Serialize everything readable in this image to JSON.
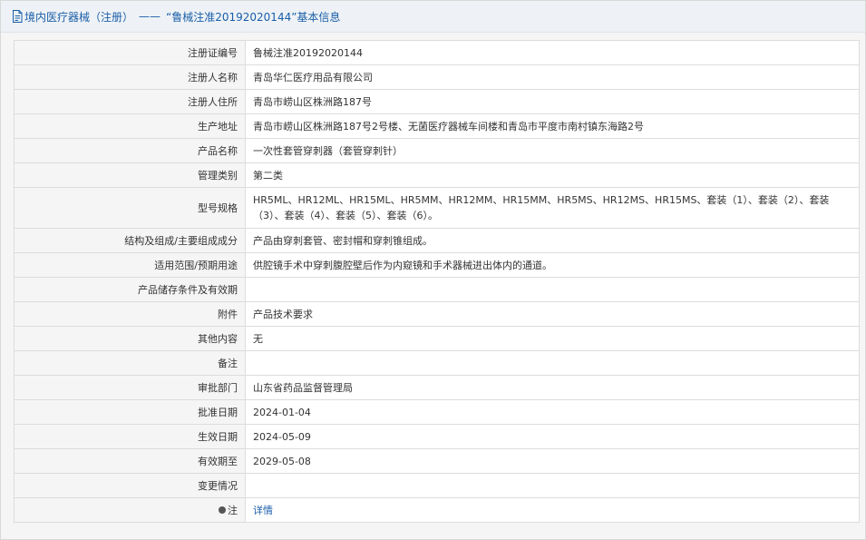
{
  "header": {
    "title_prefix": "境内医疗器械（注册）",
    "separator": "——",
    "title_main": "“鲁械注准20192020144”基本信息"
  },
  "rows": [
    {
      "label": "注册证编号",
      "value": "鲁械注准20192020144"
    },
    {
      "label": "注册人名称",
      "value": "青岛华仁医疗用品有限公司"
    },
    {
      "label": "注册人住所",
      "value": "青岛市崂山区株洲路187号"
    },
    {
      "label": "生产地址",
      "value": "青岛市崂山区株洲路187号2号楼、无菌医疗器械车间楼和青岛市平度市南村镇东海路2号"
    },
    {
      "label": "产品名称",
      "value": "一次性套管穿刺器（套管穿刺针）"
    },
    {
      "label": "管理类别",
      "value": "第二类"
    },
    {
      "label": "型号规格",
      "value": "HR5ML、HR12ML、HR15ML、HR5MM、HR12MM、HR15MM、HR5MS、HR12MS、HR15MS、套装（1）、套装（2）、套装（3）、套装（4）、套装（5）、套装（6）。"
    },
    {
      "label": "结构及组成/主要组成成分",
      "value": "产品由穿刺套管、密封帽和穿刺锥组成。"
    },
    {
      "label": "适用范围/预期用途",
      "value": "供腔镜手术中穿刺腹腔壁后作为内窥镜和手术器械进出体内的通道。"
    },
    {
      "label": "产品储存条件及有效期",
      "value": ""
    },
    {
      "label": "附件",
      "value": "产品技术要求"
    },
    {
      "label": "其他内容",
      "value": "无"
    },
    {
      "label": "备注",
      "value": ""
    },
    {
      "label": "审批部门",
      "value": "山东省药品监督管理局"
    },
    {
      "label": "批准日期",
      "value": "2024-01-04"
    },
    {
      "label": "生效日期",
      "value": "2024-05-09"
    },
    {
      "label": "有效期至",
      "value": "2029-05-08"
    },
    {
      "label": "变更情况",
      "value": ""
    }
  ],
  "note": {
    "label": "注",
    "link": "详情"
  },
  "colors": {
    "link": "#1a5ea8",
    "label_bg": "#f5f5f5",
    "border": "#dcdcdc"
  }
}
